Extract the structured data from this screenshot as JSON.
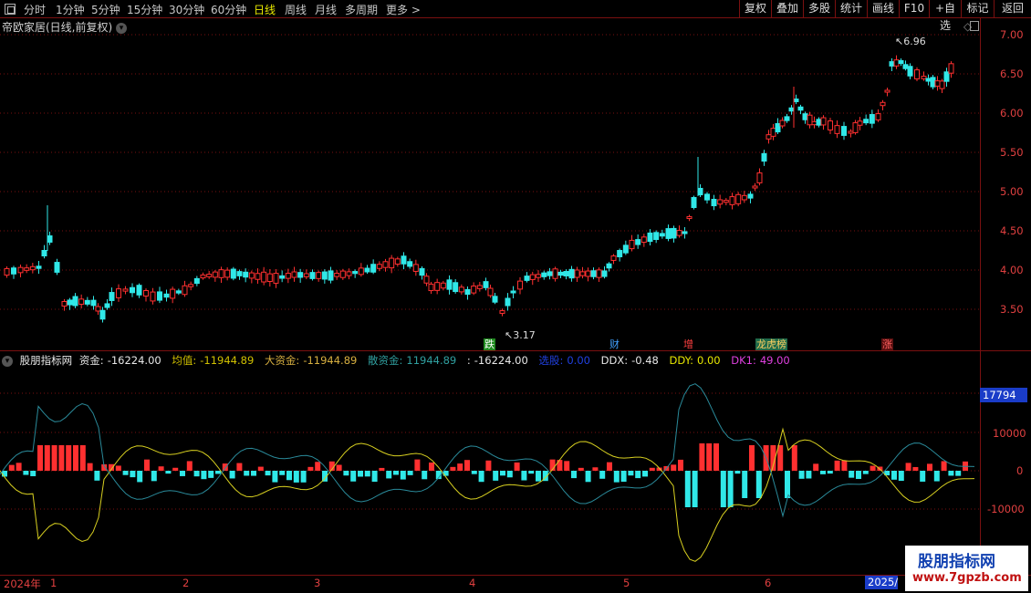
{
  "toolbar": {
    "periods": [
      "分时",
      "1分钟",
      "5分钟",
      "15分钟",
      "30分钟",
      "60分钟",
      "日线",
      "周线",
      "月线",
      "多周期",
      "更多 >"
    ],
    "active_period": "日线",
    "right_buttons": [
      "复权",
      "叠加",
      "多股",
      "统计",
      "画线",
      "F10",
      "+自选",
      "返回"
    ]
  },
  "main_chart": {
    "title": "帝欧家居(日线,前复权)",
    "price_ticks": [
      "7.00",
      "6.50",
      "6.00",
      "5.50",
      "5.00",
      "4.50",
      "4.00",
      "3.50"
    ],
    "high_label": "6.96",
    "low_label": "3.17",
    "events": [
      {
        "text": "跌",
        "bg": "#1f8a1f",
        "color": "#ffffff"
      },
      {
        "text": "财",
        "bg": "#000000",
        "color": "#40a0ff"
      },
      {
        "text": "增",
        "bg": "#000000",
        "color": "#ff4040"
      },
      {
        "text": "龙虎榜",
        "bg": "#1f6a4a",
        "color": "#ffd060"
      },
      {
        "text": "涨",
        "bg": "#5a1010",
        "color": "#ff6060"
      }
    ]
  },
  "indicator": {
    "name": "股朋指标网",
    "items": [
      {
        "label": "资金:",
        "value": "-16224.00",
        "color": "#e8e8e8"
      },
      {
        "label": "均值:",
        "value": "-11944.89",
        "color": "#d0c000"
      },
      {
        "label": "大资金:",
        "value": "-11944.89",
        "color": "#d8b040"
      },
      {
        "label": "散资金:",
        "value": "11944.89",
        "color": "#30a0a0"
      },
      {
        "label": ":",
        "value": "-16224.00",
        "color": "#e8e8e8"
      },
      {
        "label": "选股:",
        "value": "0.00",
        "color": "#2040e0"
      },
      {
        "label": "DDX:",
        "value": "-0.48",
        "color": "#e8e8e8"
      },
      {
        "label": "DDY:",
        "value": "0.00",
        "color": "#e8e800"
      },
      {
        "label": "DK1:",
        "value": "49.00",
        "color": "#e040e0"
      }
    ],
    "ticks": [
      "10000",
      "0",
      "-10000"
    ],
    "last_value": "17794"
  },
  "dates": {
    "labels": [
      "2024年",
      "1",
      "2",
      "3",
      "4",
      "5",
      "6"
    ],
    "end_label": "2025/"
  },
  "watermark": {
    "line1": "股朋指标网",
    "line2": "www.7gpzb.com"
  },
  "colors": {
    "up": "#ff3030",
    "down": "#30e8e8",
    "grid": "#7a1010",
    "yellow_line": "#d8d020",
    "cyan_line": "#2a8a9a"
  }
}
